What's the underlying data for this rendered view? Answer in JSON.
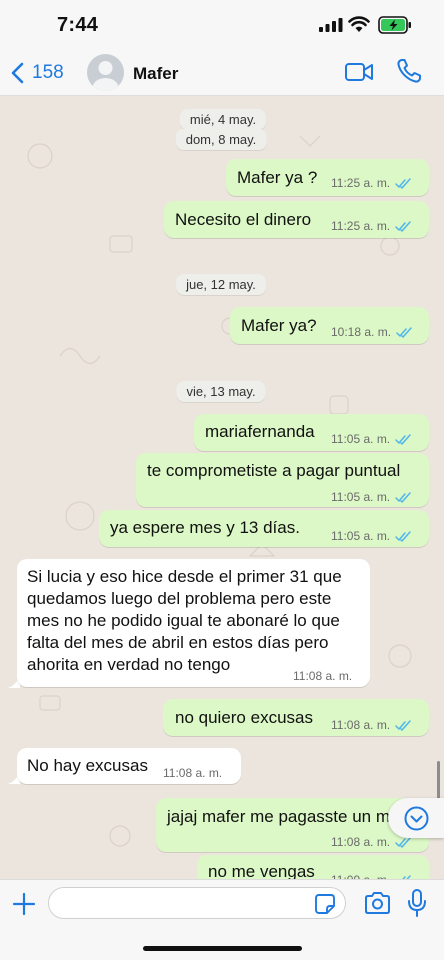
{
  "status_bar": {
    "time": "7:44"
  },
  "header": {
    "back_count": "158",
    "contact_name": "Mafer"
  },
  "dates": [
    "mié, 4 may.",
    "dom, 8 may.",
    "jue, 12 may.",
    "vie, 13 may."
  ],
  "messages": [
    {
      "direction": "out",
      "text": "Mafer ya ?",
      "time": "11:25 a. m.",
      "read": true
    },
    {
      "direction": "out",
      "text": "Necesito el dinero",
      "time": "11:25 a. m.",
      "read": true
    },
    {
      "direction": "out",
      "text": "Mafer ya?",
      "time": "10:18 a. m.",
      "read": true
    },
    {
      "direction": "out",
      "text": "mariafernanda",
      "time": "11:05 a. m.",
      "read": true
    },
    {
      "direction": "out",
      "text": "te comprometiste a pagar puntual",
      "time": "11:05 a. m.",
      "read": true
    },
    {
      "direction": "out",
      "text": "ya espere mes y 13 días.",
      "time": "11:05 a. m.",
      "read": true
    },
    {
      "direction": "in",
      "lines": [
        "Si lucia y eso hice desde el primer 31 que",
        "quedamos luego del problema pero este",
        "mes no he podido igual te abonaré lo que",
        "falta del mes de abril en estos días pero",
        "ahorita en verdad no tengo"
      ],
      "time": "11:08 a. m."
    },
    {
      "direction": "out",
      "text": "no quiero excusas",
      "time": "11:08 a. m.",
      "read": true
    },
    {
      "direction": "in",
      "text": "No hay excusas",
      "time": "11:08 a. m."
    },
    {
      "direction": "out",
      "text": "jajaj mafer me pagasste un m",
      "time": "11:08 a. m.",
      "read": true
    },
    {
      "direction": "out",
      "text": "no me vengas",
      "time": "11:09 a. m.",
      "read": true
    }
  ],
  "composer": {
    "placeholder": ""
  },
  "colors": {
    "accent": "#1f7ae0",
    "outgoing_bubble": "#dcf8c6",
    "incoming_bubble": "#ffffff",
    "chat_bg": "#ece5dd",
    "read_ticks": "#4fb6ec"
  },
  "icons": [
    "chevron-left-icon",
    "video-camera-icon",
    "phone-icon",
    "plus-icon",
    "sticker-icon",
    "camera-icon",
    "microphone-icon",
    "chevron-down-icon"
  ]
}
